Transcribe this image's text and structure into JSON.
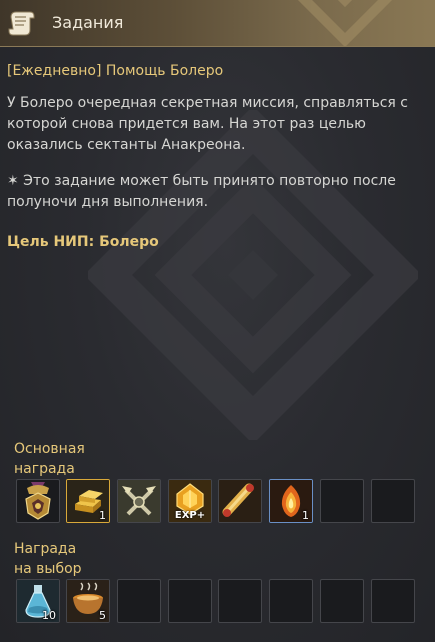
{
  "window": {
    "title": "Задания"
  },
  "quest": {
    "title": "[Ежедневно] Помощь Болеро",
    "description_lines": [
      "У Болеро очередная секретная миссия, справляться с",
      "которой снова придется вам. На этот раз целью",
      "оказались сектанты Анакреона."
    ],
    "note_lines": [
      "✶ Это задание может быть принято повторно после",
      "полуночи дня выполнения."
    ],
    "npc": "Цель НИП: Болеро"
  },
  "rewards": {
    "main_label": [
      "Основная",
      "награда"
    ],
    "main_items": [
      {
        "icon": "medal-icon",
        "qty": ""
      },
      {
        "icon": "gold-bars-icon",
        "qty": "1"
      },
      {
        "icon": "crossed-weapons-icon",
        "qty": ""
      },
      {
        "icon": "exp-crystal-icon",
        "qty": "",
        "caption": "EXP+"
      },
      {
        "icon": "scroll-icon",
        "qty": ""
      },
      {
        "icon": "fire-gem-icon",
        "qty": "1"
      }
    ],
    "choice_label": [
      "Награда",
      "на выбор"
    ],
    "choice_items": [
      {
        "icon": "potion-flask-icon",
        "qty": "10"
      },
      {
        "icon": "food-bowl-icon",
        "qty": "5"
      }
    ]
  },
  "colors": {
    "accent_gold": "#e6c87a",
    "text": "#d6d6d3",
    "selected_gold": "#d9a93a",
    "selected_blue": "#6a90c6"
  }
}
